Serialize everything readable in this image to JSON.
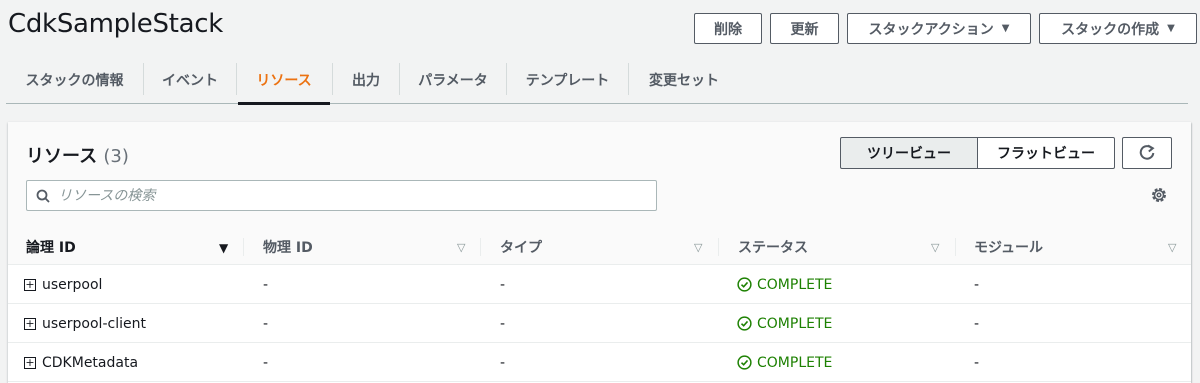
{
  "header": {
    "title": "CdkSampleStack",
    "buttons": {
      "delete": "削除",
      "update": "更新",
      "stack_actions": "スタックアクション",
      "create_stack": "スタックの作成"
    }
  },
  "tabs": [
    {
      "label": "スタックの情報"
    },
    {
      "label": "イベント"
    },
    {
      "label": "リソース"
    },
    {
      "label": "出力"
    },
    {
      "label": "パラメータ"
    },
    {
      "label": "テンプレート"
    },
    {
      "label": "変更セット"
    }
  ],
  "active_tab": "リソース",
  "resources": {
    "title": "リソース",
    "count": "(3)",
    "view_toggle": {
      "tree": "ツリービュー",
      "flat": "フラットビュー",
      "selected": "ツリービュー"
    },
    "search": {
      "placeholder": "リソースの検索",
      "value": ""
    },
    "columns": [
      "論理 ID",
      "物理 ID",
      "タイプ",
      "ステータス",
      "モジュール"
    ],
    "rows": [
      {
        "logical_id": "userpool",
        "physical_id": "-",
        "type": "-",
        "status": "COMPLETE",
        "module": "-"
      },
      {
        "logical_id": "userpool-client",
        "physical_id": "-",
        "type": "-",
        "status": "COMPLETE",
        "module": "-"
      },
      {
        "logical_id": "CDKMetadata",
        "physical_id": "-",
        "type": "-",
        "status": "COMPLETE",
        "module": "-"
      }
    ]
  },
  "icons": {
    "caret": "caret-down-icon",
    "search": "search-icon",
    "refresh": "refresh-icon",
    "settings": "gear-icon",
    "expand": "plus-square-icon",
    "status": "check-circle-icon"
  },
  "colors": {
    "accent": "#ec7211",
    "success": "#1d8102",
    "text": "#16191f"
  }
}
